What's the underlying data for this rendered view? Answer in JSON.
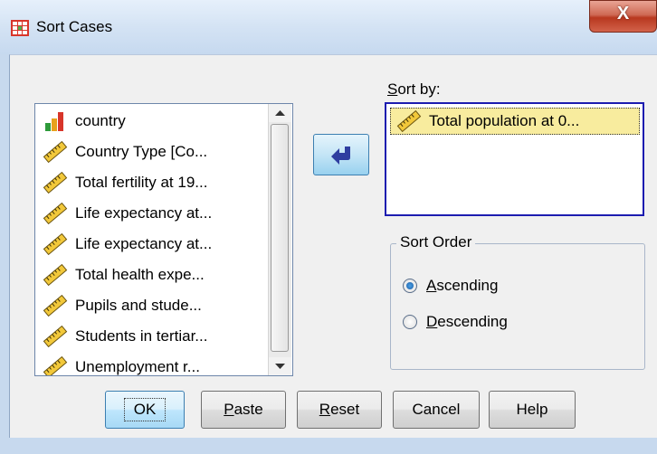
{
  "window": {
    "title": "Sort Cases",
    "close_label": "X"
  },
  "variables": {
    "items": [
      {
        "label": "country",
        "icon": "nominal-bar-icon"
      },
      {
        "label": "Country Type [Co...",
        "icon": "scale-ruler-icon"
      },
      {
        "label": "Total fertility at 19...",
        "icon": "scale-ruler-icon"
      },
      {
        "label": "Life expectancy at...",
        "icon": "scale-ruler-icon"
      },
      {
        "label": "Life expectancy at...",
        "icon": "scale-ruler-icon"
      },
      {
        "label": "Total health expe...",
        "icon": "scale-ruler-icon"
      },
      {
        "label": "Pupils and stude...",
        "icon": "scale-ruler-icon"
      },
      {
        "label": "Students in tertiar...",
        "icon": "scale-ruler-icon"
      },
      {
        "label": "Unemployment r...",
        "icon": "scale-ruler-icon"
      }
    ]
  },
  "move_button": {
    "icon": "arrow-left-icon"
  },
  "sort_by": {
    "label_first": "S",
    "label_rest": "ort by:",
    "items": [
      {
        "label": "Total population at 0...",
        "icon": "scale-ruler-icon"
      }
    ]
  },
  "sort_order": {
    "legend": "Sort Order",
    "ascending": {
      "accel": "A",
      "rest": "scending",
      "selected": true
    },
    "descending": {
      "accel": "D",
      "rest": "escending",
      "selected": false
    }
  },
  "buttons": {
    "ok": "OK",
    "paste": {
      "accel": "P",
      "rest": "aste"
    },
    "reset": {
      "accel": "R",
      "rest": "eset"
    },
    "cancel": "Cancel",
    "help": "Help"
  },
  "colors": {
    "selection": "#f8ec9e",
    "focus_border": "#1c1cb0",
    "accent": "#3c7fb1"
  }
}
